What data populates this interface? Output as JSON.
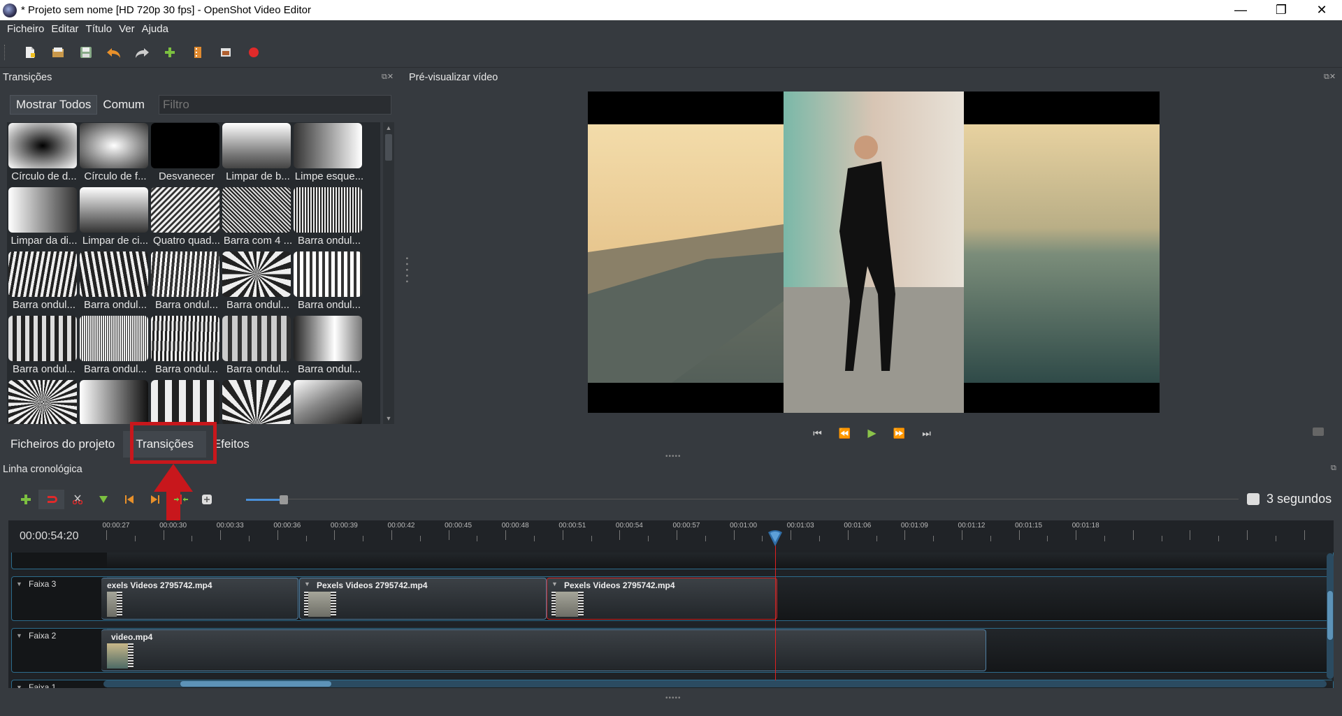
{
  "window": {
    "title": "* Projeto sem nome [HD 720p 30 fps] - OpenShot Video Editor",
    "minimize": "—",
    "restore": "❐",
    "close": "✕"
  },
  "menu": [
    "Ficheiro",
    "Editar",
    "Título",
    "Ver",
    "Ajuda"
  ],
  "toolbar": {
    "icons": [
      "new-project-icon",
      "open-project-icon",
      "save-project-icon",
      "undo-icon",
      "redo-icon",
      "import-files-icon",
      "profile-icon",
      "fullscreen-icon",
      "record-icon"
    ]
  },
  "transitions_panel": {
    "title": "Transições",
    "filter_all": "Mostrar Todos",
    "filter_common": "Comum",
    "filter_placeholder": "Filtro",
    "items": [
      {
        "label": "Círculo de d..."
      },
      {
        "label": "Círculo de f..."
      },
      {
        "label": "Desvanecer"
      },
      {
        "label": "Limpar de b..."
      },
      {
        "label": "Limpe esque..."
      },
      {
        "label": "Limpar da di..."
      },
      {
        "label": "Limpar de ci..."
      },
      {
        "label": "Quatro quad..."
      },
      {
        "label": "Barra com 4 ..."
      },
      {
        "label": "Barra ondul..."
      },
      {
        "label": "Barra ondul..."
      },
      {
        "label": "Barra ondul..."
      },
      {
        "label": "Barra ondul..."
      },
      {
        "label": "Barra ondul..."
      },
      {
        "label": "Barra ondul..."
      },
      {
        "label": "Barra ondul..."
      },
      {
        "label": "Barra ondul..."
      },
      {
        "label": "Barra ondul..."
      },
      {
        "label": "Barra ondul..."
      },
      {
        "label": "Barra ondul..."
      },
      {
        "label": ""
      },
      {
        "label": ""
      },
      {
        "label": ""
      },
      {
        "label": ""
      },
      {
        "label": ""
      }
    ]
  },
  "panel_tabs": {
    "project_files": "Ficheiros do projeto",
    "transitions": "Transições",
    "effects": "Efeitos"
  },
  "preview": {
    "title": "Pré-visualizar vídeo"
  },
  "playback": {
    "start": "⏮",
    "rewind": "⏪",
    "play": "▶",
    "forward": "⏩",
    "end": "⏭"
  },
  "timeline": {
    "title": "Linha cronológica",
    "timecode": "00:00:54:20",
    "scale_label": "3 segundos",
    "ruler_labels": [
      "00:00:27",
      "00:00:30",
      "00:00:33",
      "00:00:36",
      "00:00:39",
      "00:00:42",
      "00:00:45",
      "00:00:48",
      "00:00:51",
      "00:00:54",
      "00:00:57",
      "00:01:00",
      "00:01:03",
      "00:01:06",
      "00:01:09",
      "00:01:12",
      "00:01:15",
      "00:01:18"
    ],
    "tracks": [
      {
        "name": "Faixa 3",
        "clips": [
          "exels Videos 2795742.mp4",
          "Pexels Videos 2795742.mp4",
          "Pexels Videos 2795742.mp4"
        ]
      },
      {
        "name": "Faixa 2",
        "clips": [
          "video.mp4"
        ]
      },
      {
        "name": "Faixa 1",
        "clips": []
      }
    ]
  },
  "colors": {
    "background": "#363a3f",
    "highlight": "#c8171c",
    "play_green": "#8bc34a",
    "playhead": "#e02020"
  }
}
